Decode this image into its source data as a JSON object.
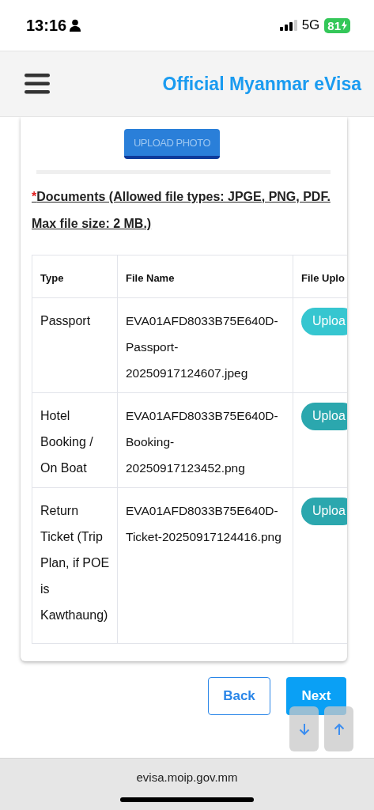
{
  "status_bar": {
    "time": "13:16",
    "network": "5G",
    "battery": "81"
  },
  "header": {
    "title": "Official Myanmar eVisa"
  },
  "photo_upload": {
    "button": "UPLOAD PHOTO"
  },
  "documents": {
    "required_mark": "*",
    "heading": "Documents (Allowed file types: JPGE, PNG, PDF. Max file size: 2 MB.)",
    "columns": [
      "Type",
      "File Name",
      "File Uplo"
    ],
    "rows": [
      {
        "type": "Passport",
        "file_name": "EVA01AFD8033B75E640D-Passport-20250917124607.jpeg",
        "button": "Uploa",
        "highlighted": true
      },
      {
        "type": "Hotel Booking / On Boat",
        "file_name": "EVA01AFD8033B75E640D-Booking-20250917123452.png",
        "button": "Uploa",
        "highlighted": false
      },
      {
        "type": "Return Ticket (Trip Plan, if POE is Kawthaung)",
        "file_name": "EVA01AFD8033B75E640D-Ticket-20250917124416.png",
        "button": "Uploa",
        "highlighted": false
      }
    ]
  },
  "actions": {
    "back": "Back",
    "next": "Next"
  },
  "browser": {
    "url": "evisa.moip.gov.mm"
  }
}
